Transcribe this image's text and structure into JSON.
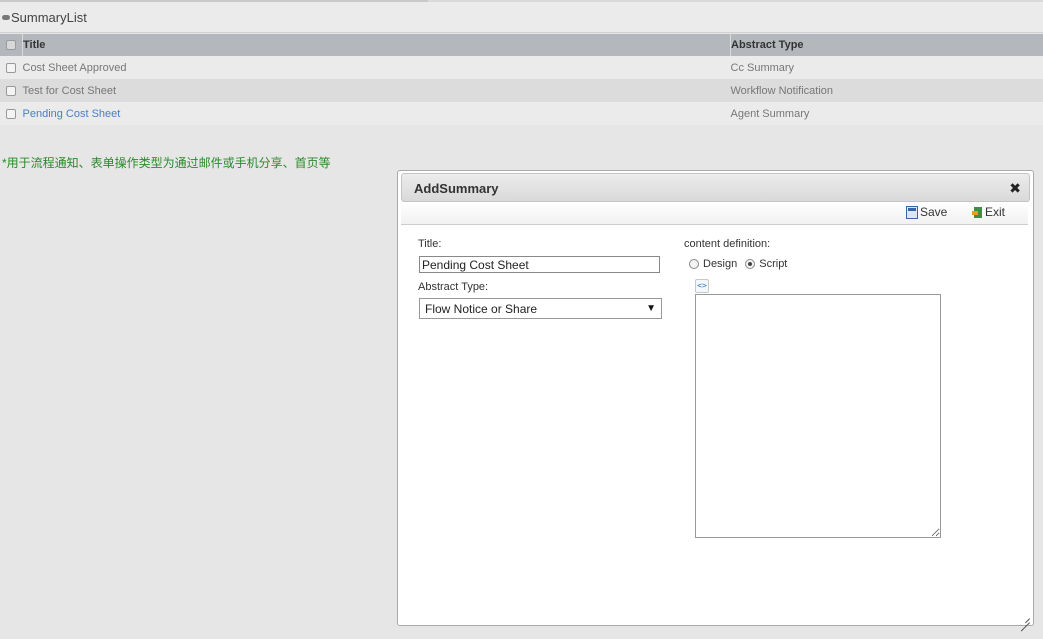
{
  "list": {
    "title": "SummaryList",
    "columns": {
      "title": "Title",
      "type": "Abstract Type"
    },
    "rows": [
      {
        "title": "Cost Sheet Approved",
        "type": "Cc Summary"
      },
      {
        "title": "Test for Cost Sheet",
        "type": "Workflow Notification"
      },
      {
        "title": "Pending Cost Sheet",
        "type": "Agent Summary"
      }
    ]
  },
  "note": "*用于流程通知、表单操作类型为通过邮件或手机分享、首页等",
  "dialog": {
    "title": "AddSummary",
    "close_glyph": "✖",
    "toolbar": {
      "save_label": "Save",
      "exit_label": "Exit"
    },
    "title_label": "Title:",
    "title_value": "Pending Cost Sheet",
    "abstract_type_label": "Abstract Type:",
    "abstract_type_value": "Flow Notice or Share",
    "content_label": "content definition:",
    "content_options": {
      "design": "Design",
      "script": "Script"
    },
    "content_selected": "Script",
    "code_icon_glyph": "<>",
    "script_value": ""
  },
  "colors": {
    "header_bg": "#b4b8bc",
    "link": "#4a7ec4",
    "note": "#2a8a2a"
  },
  "icons": [
    "collapse-toggle-icon",
    "save-icon",
    "exit-icon",
    "close-icon",
    "code-icon",
    "resize-grip-icon"
  ]
}
